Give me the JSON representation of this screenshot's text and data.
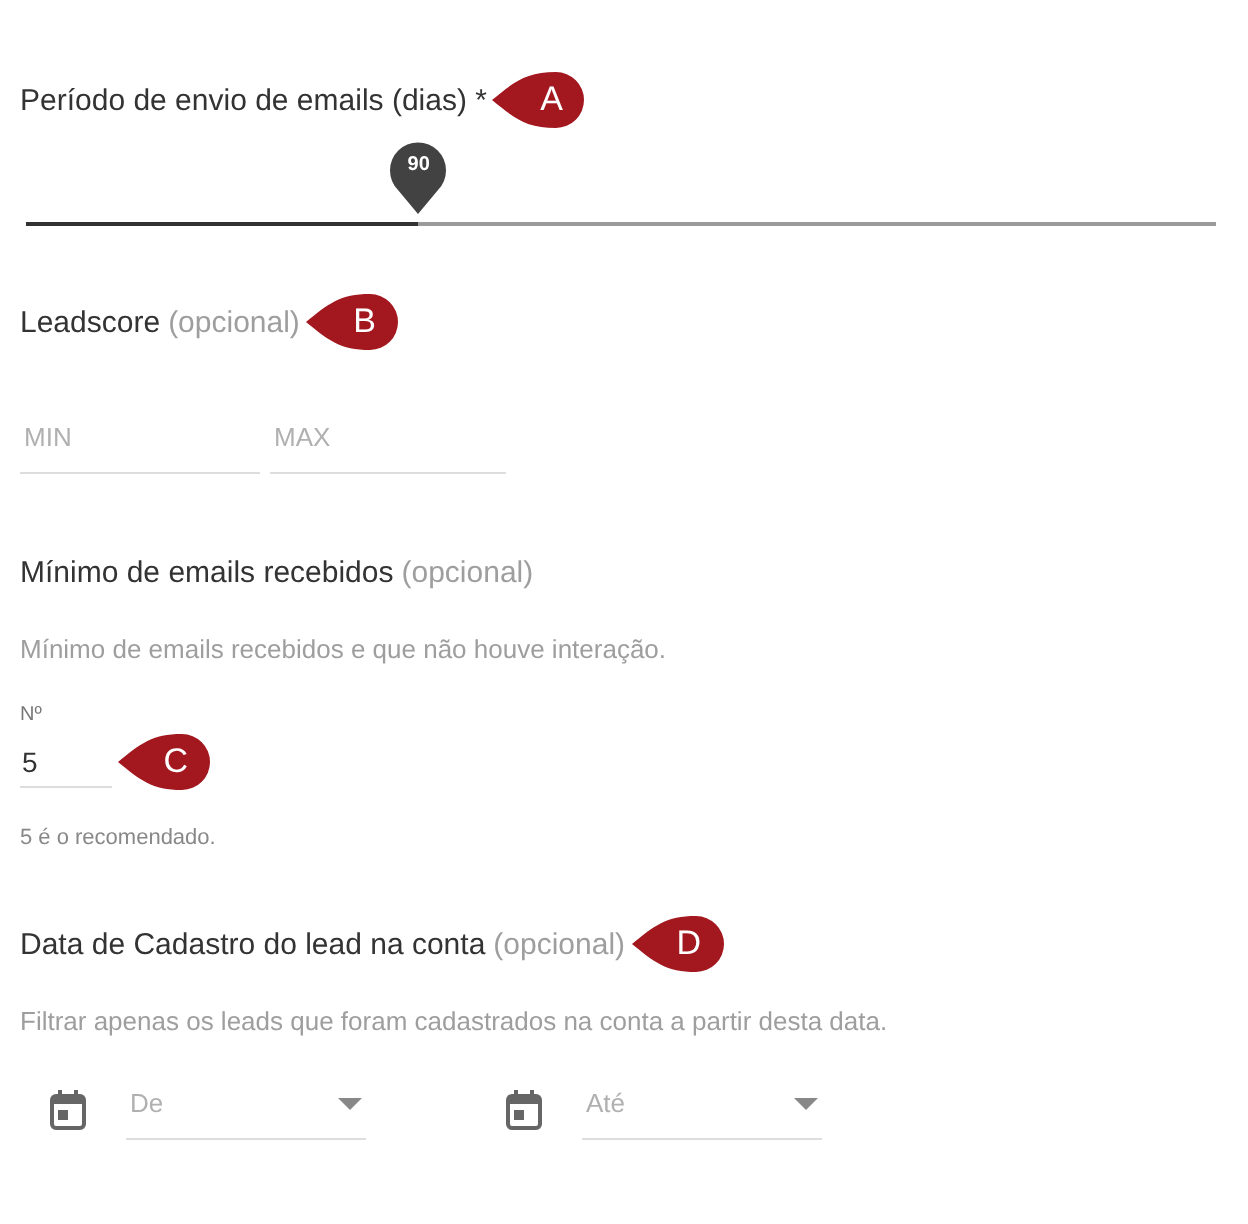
{
  "sections": [
    {
      "kind": "slider",
      "title": "Período de envio de emails (dias) *",
      "marker": "A",
      "slider": {
        "value": "90",
        "level": 0.33
      }
    },
    {
      "kind": "range",
      "title": "Leadscore",
      "optional": "(opcional)",
      "marker": "B",
      "fields": [
        {
          "placeholder": "MIN"
        },
        {
          "placeholder": "MAX"
        }
      ]
    },
    {
      "kind": "number",
      "title": "Mínimo de emails recebidos",
      "optional": "(opcional)",
      "description": "Mínimo de emails recebidos e que não houve interação.",
      "field": {
        "label": "Nº",
        "value": "5",
        "marker": "C"
      },
      "hint": "5 é o recomendado."
    },
    {
      "kind": "dates",
      "title": "Data de Cadastro do lead na conta",
      "optional": "(opcional)",
      "marker": "D",
      "description": "Filtrar apenas os leads que foram cadastrados na conta a partir desta data.",
      "fields": [
        {
          "placeholder": "De"
        },
        {
          "placeholder": "Até"
        }
      ]
    }
  ]
}
